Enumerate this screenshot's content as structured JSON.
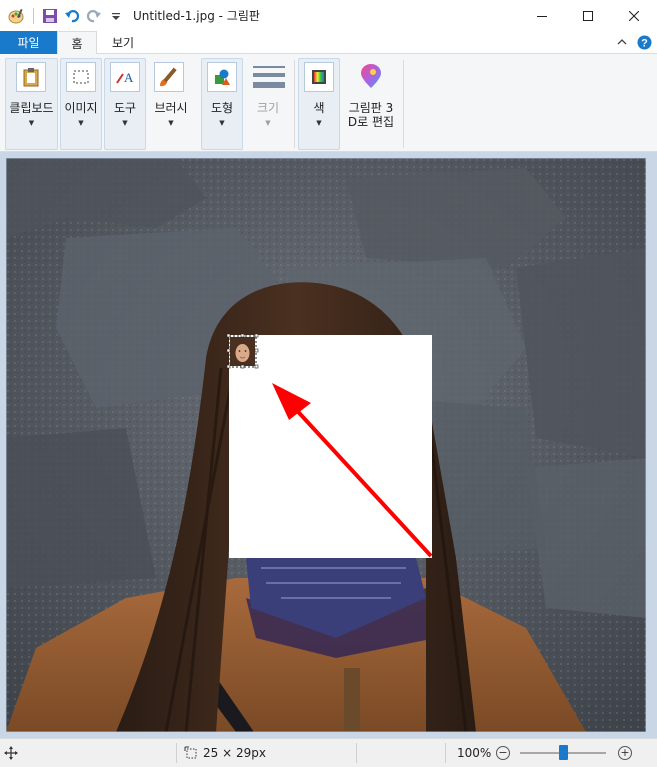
{
  "window": {
    "title": "Untitled-1.jpg - 그림판",
    "controls": [
      "minimize-icon",
      "maximize-icon",
      "close-icon"
    ]
  },
  "quick_access": [
    "paint-app-icon",
    "save-icon",
    "undo-icon",
    "redo-icon",
    "customize-dropdown-icon"
  ],
  "tabs": {
    "file": "파일",
    "home": "홈",
    "view": "보기"
  },
  "ribbon": {
    "clipboard": "클립보드",
    "image": "이미지",
    "tools": "도구",
    "brushes": "브러시",
    "shapes": "도형",
    "size": "크기",
    "colors": "색",
    "paint3d_line1": "그림판 3",
    "paint3d_line2": "D로 편집"
  },
  "canvas": {
    "selection_content": "face-thumbnail",
    "annotation": "red-arrow",
    "colors": {
      "arrow": "#ff0000",
      "background": "#c9d6e6",
      "accent": "#1979ca"
    }
  },
  "status": {
    "selection_size": "25 × 29px",
    "zoom": "100%",
    "zoom_level": 1.0
  }
}
